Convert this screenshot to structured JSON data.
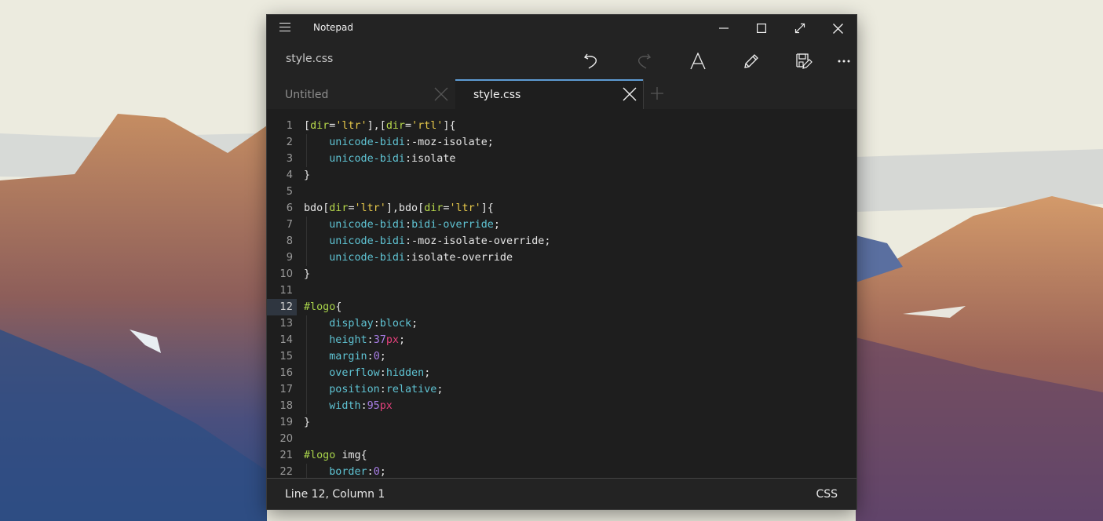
{
  "window": {
    "app_title": "Notepad",
    "document_title": "style.css",
    "controls": [
      "minimize-icon",
      "maximize-icon",
      "fullscreen-icon",
      "close-icon"
    ]
  },
  "toolbar": {
    "buttons": [
      {
        "name": "undo",
        "icon": "undo-icon",
        "enabled": true
      },
      {
        "name": "redo",
        "icon": "redo-icon",
        "enabled": false
      },
      {
        "name": "font",
        "icon": "font-icon",
        "enabled": true
      },
      {
        "name": "edit",
        "icon": "pencil-icon",
        "enabled": true
      },
      {
        "name": "save",
        "icon": "save-icon",
        "enabled": true
      },
      {
        "name": "more",
        "icon": "more-icon",
        "enabled": true
      }
    ]
  },
  "tabs": [
    {
      "label": "Untitled",
      "active": false
    },
    {
      "label": "style.css",
      "active": true
    }
  ],
  "editor": {
    "current_line": 12,
    "lines": [
      {
        "n": "1",
        "tokens": [
          [
            "punc",
            "["
          ],
          [
            "attr",
            "dir"
          ],
          [
            "punc",
            "="
          ],
          [
            "str",
            "'ltr'"
          ],
          [
            "punc",
            "],["
          ],
          [
            "attr",
            "dir"
          ],
          [
            "punc",
            "="
          ],
          [
            "str",
            "'rtl'"
          ],
          [
            "punc",
            "]{"
          ]
        ]
      },
      {
        "n": "2",
        "tokens": [
          [
            "ind",
            "    "
          ],
          [
            "prop",
            "unicode-bidi"
          ],
          [
            "punc",
            ":-moz-isolate;"
          ]
        ]
      },
      {
        "n": "3",
        "tokens": [
          [
            "ind",
            "    "
          ],
          [
            "prop",
            "unicode-bidi"
          ],
          [
            "punc",
            ":isolate"
          ]
        ]
      },
      {
        "n": "4",
        "tokens": [
          [
            "punc",
            "}"
          ]
        ]
      },
      {
        "n": "5",
        "tokens": []
      },
      {
        "n": "6",
        "tokens": [
          [
            "sel",
            "bdo"
          ],
          [
            "punc",
            "["
          ],
          [
            "attr",
            "dir"
          ],
          [
            "punc",
            "="
          ],
          [
            "str",
            "'ltr'"
          ],
          [
            "punc",
            "],bdo["
          ],
          [
            "attr",
            "dir"
          ],
          [
            "punc",
            "="
          ],
          [
            "str",
            "'ltr'"
          ],
          [
            "punc",
            "]{"
          ]
        ]
      },
      {
        "n": "7",
        "tokens": [
          [
            "ind",
            "    "
          ],
          [
            "prop",
            "unicode-bidi"
          ],
          [
            "punc",
            ":"
          ],
          [
            "val",
            "bidi-override"
          ],
          [
            "punc",
            ";"
          ]
        ]
      },
      {
        "n": "8",
        "tokens": [
          [
            "ind",
            "    "
          ],
          [
            "prop",
            "unicode-bidi"
          ],
          [
            "punc",
            ":-moz-isolate-override;"
          ]
        ]
      },
      {
        "n": "9",
        "tokens": [
          [
            "ind",
            "    "
          ],
          [
            "prop",
            "unicode-bidi"
          ],
          [
            "punc",
            ":isolate-override"
          ]
        ]
      },
      {
        "n": "10",
        "tokens": [
          [
            "punc",
            "}"
          ]
        ]
      },
      {
        "n": "11",
        "tokens": []
      },
      {
        "n": "12",
        "tokens": [
          [
            "id",
            "#logo"
          ],
          [
            "punc",
            "{"
          ]
        ]
      },
      {
        "n": "13",
        "tokens": [
          [
            "ind",
            "    "
          ],
          [
            "prop",
            "display"
          ],
          [
            "punc",
            ":"
          ],
          [
            "val",
            "block"
          ],
          [
            "punc",
            ";"
          ]
        ]
      },
      {
        "n": "14",
        "tokens": [
          [
            "ind",
            "    "
          ],
          [
            "prop",
            "height"
          ],
          [
            "punc",
            ":"
          ],
          [
            "num",
            "37"
          ],
          [
            "unit",
            "px"
          ],
          [
            "punc",
            ";"
          ]
        ]
      },
      {
        "n": "15",
        "tokens": [
          [
            "ind",
            "    "
          ],
          [
            "prop",
            "margin"
          ],
          [
            "punc",
            ":"
          ],
          [
            "num",
            "0"
          ],
          [
            "punc",
            ";"
          ]
        ]
      },
      {
        "n": "16",
        "tokens": [
          [
            "ind",
            "    "
          ],
          [
            "prop",
            "overflow"
          ],
          [
            "punc",
            ":"
          ],
          [
            "val",
            "hidden"
          ],
          [
            "punc",
            ";"
          ]
        ]
      },
      {
        "n": "17",
        "tokens": [
          [
            "ind",
            "    "
          ],
          [
            "prop",
            "position"
          ],
          [
            "punc",
            ":"
          ],
          [
            "val",
            "relative"
          ],
          [
            "punc",
            ";"
          ]
        ]
      },
      {
        "n": "18",
        "tokens": [
          [
            "ind",
            "    "
          ],
          [
            "prop",
            "width"
          ],
          [
            "punc",
            ":"
          ],
          [
            "num",
            "95"
          ],
          [
            "unit",
            "px"
          ]
        ]
      },
      {
        "n": "19",
        "tokens": [
          [
            "punc",
            "}"
          ]
        ]
      },
      {
        "n": "20",
        "tokens": []
      },
      {
        "n": "21",
        "tokens": [
          [
            "id",
            "#logo"
          ],
          [
            "sel",
            " img"
          ],
          [
            "punc",
            "{"
          ]
        ]
      },
      {
        "n": "22",
        "tokens": [
          [
            "ind",
            "    "
          ],
          [
            "prop",
            "border"
          ],
          [
            "punc",
            ":"
          ],
          [
            "num",
            "0"
          ],
          [
            "punc",
            ";"
          ]
        ]
      }
    ]
  },
  "status": {
    "position": "Line 12, Column 1",
    "language": "CSS"
  },
  "colors": {
    "accent": "#5d9bd3",
    "window_bg": "#232323",
    "editor_bg": "#1e1e1e"
  }
}
